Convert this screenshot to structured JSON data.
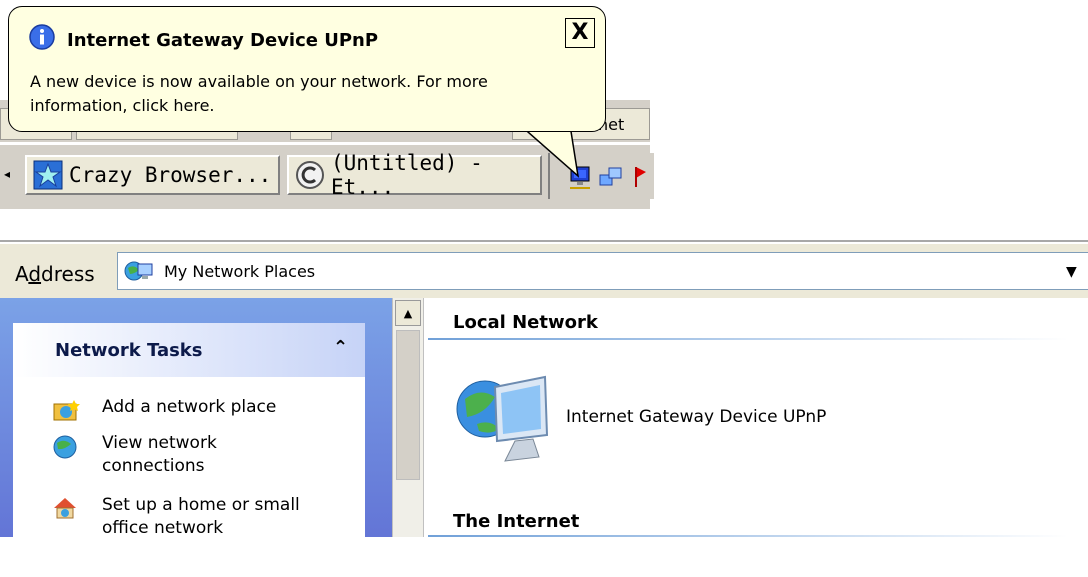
{
  "balloon": {
    "title": "Internet Gateway Device UPnP",
    "message": "A new device is now available on your network. For more information, click here.",
    "close_label": "X"
  },
  "taskbar": {
    "upper_partial_text": "net",
    "buttons": [
      {
        "label": "Crazy Browser..."
      },
      {
        "label": "(Untitled) - Et..."
      }
    ]
  },
  "address_bar": {
    "label_prefix": "A",
    "label_underlined": "d",
    "label_suffix": "dress",
    "value": "My Network Places"
  },
  "task_pane": {
    "title": "Network Tasks",
    "collapse_glyph": "˄",
    "items": [
      {
        "label": "Add a network place"
      },
      {
        "label": "View network connections"
      },
      {
        "label": "Set up a home or small office network"
      }
    ]
  },
  "content": {
    "groups": [
      {
        "title": "Local Network"
      },
      {
        "title": "The Internet"
      }
    ],
    "devices": [
      {
        "label": "Internet Gateway Device UPnP"
      }
    ]
  },
  "colors": {
    "balloon_bg": "#ffffe1",
    "taskbar_bg": "#d4d0c8",
    "taskpane_gradient_top": "#7ba2e7",
    "accent_blue": "#215dc6"
  }
}
